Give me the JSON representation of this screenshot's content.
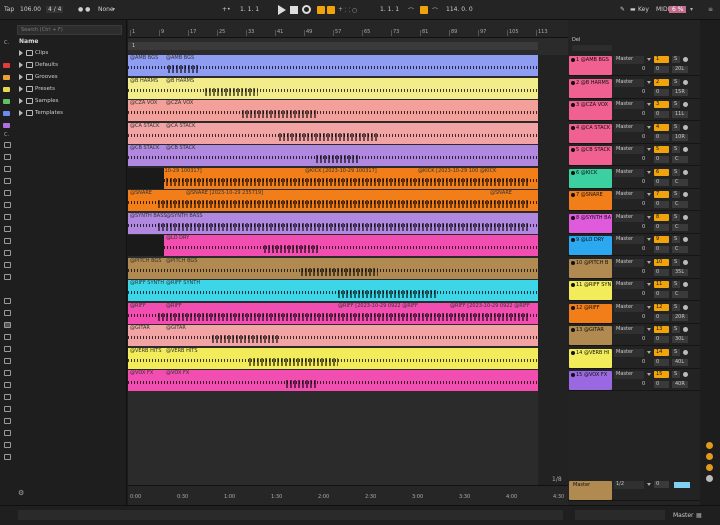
{
  "topbar": {
    "tempo_label": "Tap",
    "tempo": "106.00",
    "time_sig": "4 / 4",
    "metronome": "● ●",
    "quantize": "None",
    "position": "1.   1.   1",
    "loop_start": "1.   1.   1",
    "loop_len": "114.   0.   0",
    "key_label": "Key",
    "midi_label": "MIDI",
    "cpu": "6 %"
  },
  "browser": {
    "search_placeholder": "Search (Ctrl + F)",
    "tree_header": "Name",
    "collections_label": "C.",
    "places_label": "C.",
    "items": [
      {
        "label": "Clips"
      },
      {
        "label": "Defaults"
      },
      {
        "label": "Grooves"
      },
      {
        "label": "Presets"
      },
      {
        "label": "Samples"
      },
      {
        "label": "Templates"
      }
    ],
    "category_colors": [
      "#e23b3b",
      "#f0a030",
      "#e8d84a",
      "#5fc15f",
      "#6a8cf0",
      "#b070e0"
    ]
  },
  "ruler": {
    "bars": [
      "1",
      "9",
      "17",
      "25",
      "33",
      "41",
      "49",
      "57",
      "65",
      "73",
      "81",
      "89",
      "97",
      "105",
      "113"
    ],
    "loop_label": "1"
  },
  "timeline": {
    "times": [
      "0:00",
      "0:30",
      "1:00",
      "1:30",
      "2:00",
      "2:30",
      "3:00",
      "3:30",
      "4:00",
      "4:30"
    ],
    "page": "1/8"
  },
  "tracks": [
    {
      "clip1": "@AMB BGS",
      "clip2": "@AMB BGS",
      "color": "#8e9cf2"
    },
    {
      "clip1": "@B HARMS",
      "clip2": "@B HARMS",
      "color": "#f2ec8a"
    },
    {
      "clip1": "@CZA VOX",
      "clip2": "@CZA VOX",
      "color": "#f4a09a"
    },
    {
      "clip1": "@CA STACK",
      "clip2": "@CA STACK",
      "color": "#f2a4a4"
    },
    {
      "clip1": "@CB STACK",
      "clip2": "@CB STACK",
      "color": "#b088e0"
    },
    {
      "clip1": "@KICK [2023-10-29 100317]",
      "clip2": "@KICK [2023-10-29 100317]",
      "clip3": "@KICK [2023-10-29 100 @KICK",
      "color": "#f27e1a"
    },
    {
      "clip1": "@SNARE",
      "clip2": "@SNARE [2023-10-29 235719]",
      "clip3": "@SNARE",
      "color": "#f27e1a"
    },
    {
      "clip1": "@SYNTH BASS",
      "clip2": "@SYNTH BASS",
      "color": "#b088e0"
    },
    {
      "clip1": "@LO DRY",
      "clip2": "@LO DRY",
      "color": "#f24db0"
    },
    {
      "clip1": "@PITCH BGS",
      "clip2": "@PITCH BGS",
      "color": "#b08a50"
    },
    {
      "clip1": "@RIFF SYNTH",
      "clip2": "@RIFF SYNTH",
      "color": "#3cd6e8"
    },
    {
      "clip1": "@RIFF",
      "clip2": "@RIFF",
      "clip3": "@RIFF [2023-10-29 0922 @RIFF",
      "clip4": "@RIFF [2023-10-29 0922 @RIFF",
      "color": "#f24db0"
    },
    {
      "clip1": "@GITAR",
      "clip2": "@GITAR",
      "color": "#f2a4a4"
    },
    {
      "clip1": "@VERB HITS",
      "clip2": "@VERB HITS",
      "color": "#f2ec5a"
    },
    {
      "clip1": "@VOX FX",
      "clip2": "@VOX FX",
      "color": "#f24db0"
    }
  ],
  "mixer": {
    "header": "Del",
    "rows": [
      {
        "name": "1 @AMB BGS",
        "out": "Master",
        "num": "1",
        "vol": "0",
        "pan": "20L",
        "color": "#f06090"
      },
      {
        "name": "2 @B HARMS",
        "out": "Master",
        "num": "2",
        "vol": "0",
        "pan": "15R",
        "color": "#f06090"
      },
      {
        "name": "3 @CZA VOX",
        "out": "Master",
        "num": "3",
        "vol": "0",
        "pan": "11L",
        "color": "#f06090"
      },
      {
        "name": "4 @CA STACK",
        "out": "Master",
        "num": "4",
        "vol": "0",
        "pan": "10R",
        "color": "#f06090"
      },
      {
        "name": "5 @CB STACK",
        "out": "Master",
        "num": "5",
        "vol": "0",
        "pan": "C",
        "color": "#f06090"
      },
      {
        "name": "6 @KICK",
        "out": "Master",
        "num": "6",
        "vol": "0",
        "pan": "C",
        "color": "#3ccfa0"
      },
      {
        "name": "7 @SNARE",
        "out": "Master",
        "num": "7",
        "vol": "0",
        "pan": "C",
        "color": "#f27e1a"
      },
      {
        "name": "8 @SYNTH BA",
        "out": "Master",
        "num": "8",
        "vol": "0",
        "pan": "C",
        "color": "#e05adc"
      },
      {
        "name": "9 @LO DRY",
        "out": "Master",
        "num": "9",
        "vol": "0",
        "pan": "C",
        "color": "#2ca8f0"
      },
      {
        "name": "10 @PITCH B",
        "out": "Master",
        "num": "10",
        "vol": "0",
        "pan": "35L",
        "color": "#b08a50"
      },
      {
        "name": "11 @RIFF SYN",
        "out": "Master",
        "num": "11",
        "vol": "0",
        "pan": "C",
        "color": "#f2ec5a"
      },
      {
        "name": "12 @RIFF",
        "out": "Master",
        "num": "12",
        "vol": "0",
        "pan": "20R",
        "color": "#f27e1a"
      },
      {
        "name": "13 @GITAR",
        "out": "Master",
        "num": "13",
        "vol": "0",
        "pan": "30L",
        "color": "#b08a50"
      },
      {
        "name": "14 @VERB HI",
        "out": "Master",
        "num": "14",
        "vol": "0",
        "pan": "40L",
        "color": "#f2ec5a"
      },
      {
        "name": "15 @VOX FX",
        "out": "Master",
        "num": "15",
        "vol": "0",
        "pan": "40R",
        "color": "#9a68e0"
      }
    ],
    "master": {
      "name": "Master",
      "out": "1/2",
      "vol": "0",
      "color": "#b08a50"
    }
  },
  "status": {
    "master_label": "Master"
  }
}
